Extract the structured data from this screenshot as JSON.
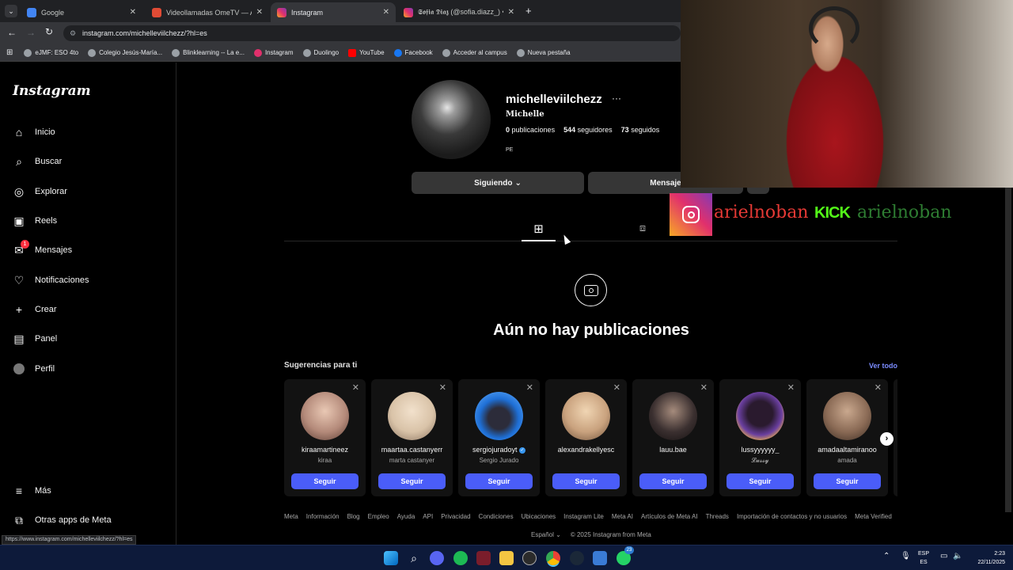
{
  "browser": {
    "tabs": [
      {
        "title": "Google",
        "color": "#4285f4"
      },
      {
        "title": "Videollamadas OmeTV — Altern",
        "color": "#e04b35"
      },
      {
        "title": "Instagram",
        "color": "#e1306c"
      },
      {
        "title": "𝕾𝖔𝖋𝖎𝖆 𝕯𝖎𝖆𝖟 (@sofia.diazz_) • F",
        "color": "#e1306c"
      }
    ],
    "url": "instagram.com/michelleviilchezz/?hl=es",
    "bookmarks": [
      "eJMF: ESO 4to",
      "Colegio Jesús-María...",
      "Blinklearning -- La e...",
      "Instagram",
      "Duolingo",
      "YouTube",
      "Facebook",
      "Acceder al campus",
      "Nueva pestaña"
    ],
    "status_url": "https://www.instagram.com/michelleviilchezz/?hl=es"
  },
  "sidebar": {
    "logo": "Instagram",
    "items": [
      {
        "label": "Inicio",
        "icon": "home-icon"
      },
      {
        "label": "Buscar",
        "icon": "search-icon"
      },
      {
        "label": "Explorar",
        "icon": "compass-icon"
      },
      {
        "label": "Reels",
        "icon": "reels-icon"
      },
      {
        "label": "Mensajes",
        "icon": "messenger-icon",
        "badge": "1"
      },
      {
        "label": "Notificaciones",
        "icon": "heart-icon"
      },
      {
        "label": "Crear",
        "icon": "plus-icon"
      },
      {
        "label": "Panel",
        "icon": "chart-icon"
      },
      {
        "label": "Perfil",
        "icon": "avatar-icon"
      }
    ],
    "more": "Más",
    "meta_apps": "Otras apps de Meta"
  },
  "profile": {
    "username": "michelleviilchezz",
    "name": "Michelle",
    "posts_count": "0",
    "posts_label": "publicaciones",
    "followers_count": "544",
    "followers_label": "seguidores",
    "following_count": "73",
    "following_label": "seguidos",
    "bio": "PE",
    "following_button": "Siguiendo",
    "message_button": "Mensaje",
    "empty_title": "Aún no hay publicaciones"
  },
  "suggestions": {
    "title": "Sugerencias para ti",
    "see_all": "Ver todo",
    "follow_label": "Seguir",
    "cards": [
      {
        "username": "kiraamartineez",
        "name": "kiraa",
        "color": "#b48a7a"
      },
      {
        "username": "maartaa.castanyerr",
        "name": "marta castanyer",
        "color": "#d9c3a8"
      },
      {
        "username": "sergiojuradoyt",
        "name": "Sergio Jurado",
        "color": "#1e6fd6",
        "verified": true
      },
      {
        "username": "alexandrakellyesc",
        "name": "",
        "color": "#c9a27e"
      },
      {
        "username": "lauu.bae",
        "name": "",
        "color": "#3b3030"
      },
      {
        "username": "lussyyyyyy_",
        "name": "𝓛𝓾𝓼𝓼𝔂",
        "color": "#6a3fa0"
      },
      {
        "username": "amadaaltamiranoo",
        "name": "amada",
        "color": "#8a6a55"
      }
    ]
  },
  "footer": {
    "links": [
      "Meta",
      "Información",
      "Blog",
      "Empleo",
      "Ayuda",
      "API",
      "Privacidad",
      "Condiciones",
      "Ubicaciones",
      "Instagram Lite",
      "Meta AI",
      "Artículos de Meta AI",
      "Threads",
      "Importación de contactos y no usuarios",
      "Meta Verified"
    ],
    "language": "Español",
    "copyright": "© 2025 Instagram from Meta"
  },
  "overlay": {
    "instagram_handle": "arielnoban",
    "kick_label": "KICK",
    "kick_handle": "arielnoban"
  },
  "taskbar": {
    "lang_top": "ESP",
    "lang_bottom": "ES",
    "time": "2:23",
    "date": "22/11/2025",
    "whatsapp_badge": "23"
  }
}
